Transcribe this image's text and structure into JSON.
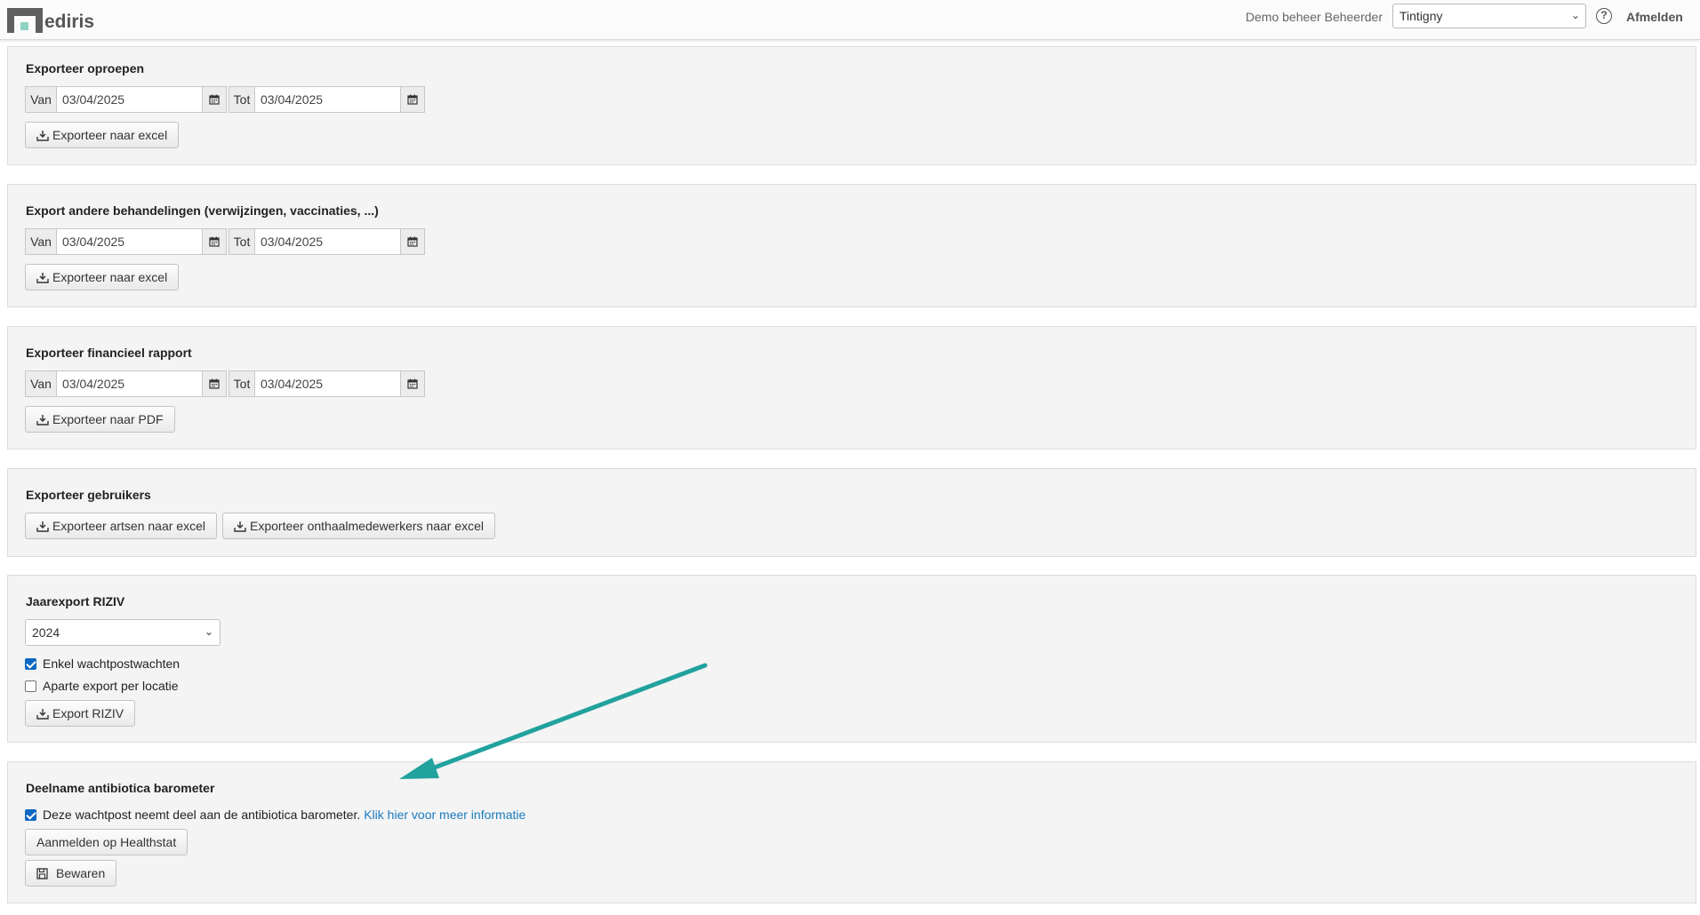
{
  "header": {
    "logo_text": "ediris",
    "user_name": "Demo beheer Beheerder",
    "location_selected": "Tintigny",
    "help_icon": "question-circle-icon",
    "logout_label": "Afmelden"
  },
  "sections": {
    "calls": {
      "title": "Exporteer oproepen",
      "from_label": "Van",
      "from_value": "03/04/2025",
      "to_label": "Tot",
      "to_value": "03/04/2025",
      "button": "Exporteer naar excel"
    },
    "treatments": {
      "title": "Export andere behandelingen (verwijzingen, vaccinaties, ...)",
      "from_label": "Van",
      "from_value": "03/04/2025",
      "to_label": "Tot",
      "to_value": "03/04/2025",
      "button": "Exporteer naar excel"
    },
    "financial": {
      "title": "Exporteer financieel rapport",
      "from_label": "Van",
      "from_value": "03/04/2025",
      "to_label": "Tot",
      "to_value": "03/04/2025",
      "button": "Exporteer naar PDF"
    },
    "users": {
      "title": "Exporteer gebruikers",
      "button_doctors": "Exporteer artsen naar excel",
      "button_reception": "Exporteer onthaalmedewerkers naar excel"
    },
    "riziv": {
      "title": "Jaarexport RIZIV",
      "year_selected": "2024",
      "checkbox_only_shifts": "Enkel wachtpostwachten",
      "checkbox_only_shifts_checked": true,
      "checkbox_per_location": "Aparte export per locatie",
      "checkbox_per_location_checked": false,
      "button": "Export RIZIV"
    },
    "antibiotics": {
      "title": "Deelname antibiotica barometer",
      "checkbox_label": "Deze wachtpost neemt deel aan de antibiotica barometer.",
      "checkbox_checked": true,
      "info_link": "Klik hier voor meer informatie",
      "register_button": "Aanmelden op Healthstat",
      "save_button": "Bewaren"
    }
  },
  "annotation": {
    "arrow_color": "#22a29e"
  }
}
